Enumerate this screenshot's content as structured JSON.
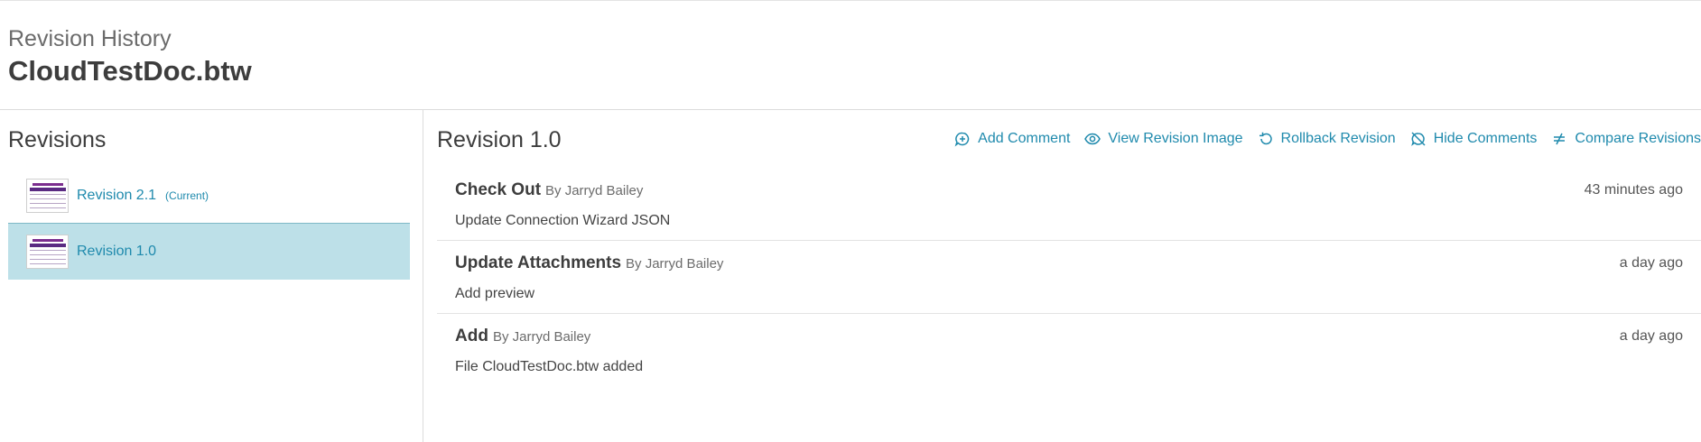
{
  "header": {
    "subtitle": "Revision History",
    "title": "CloudTestDoc.btw"
  },
  "left": {
    "title": "Revisions",
    "items": [
      {
        "label": "Revision 2.1",
        "badge": "(Current)"
      },
      {
        "label": "Revision 1.0"
      }
    ]
  },
  "main": {
    "title": "Revision 1.0",
    "toolbar": {
      "add_comment": "Add Comment",
      "view_image": "View Revision Image",
      "rollback": "Rollback Revision",
      "hide_comments": "Hide Comments",
      "compare": "Compare Revisions"
    },
    "events": [
      {
        "name": "Check Out",
        "by": "By Jarryd Bailey",
        "time": "43 minutes ago",
        "desc": "Update Connection Wizard JSON"
      },
      {
        "name": "Update Attachments",
        "by": "By Jarryd Bailey",
        "time": "a day ago",
        "desc": "Add preview"
      },
      {
        "name": "Add",
        "by": "By Jarryd Bailey",
        "time": "a day ago",
        "desc": "File CloudTestDoc.btw added"
      }
    ]
  },
  "colors": {
    "link": "#1f8aad",
    "selected_bg": "#bde0e8",
    "text_dark": "#3d3d3d"
  },
  "icons": {
    "add_comment": "comment-plus-icon",
    "view_image": "eye-icon",
    "rollback": "undo-icon",
    "hide_comments": "comment-off-icon",
    "compare": "not-equal-icon"
  }
}
